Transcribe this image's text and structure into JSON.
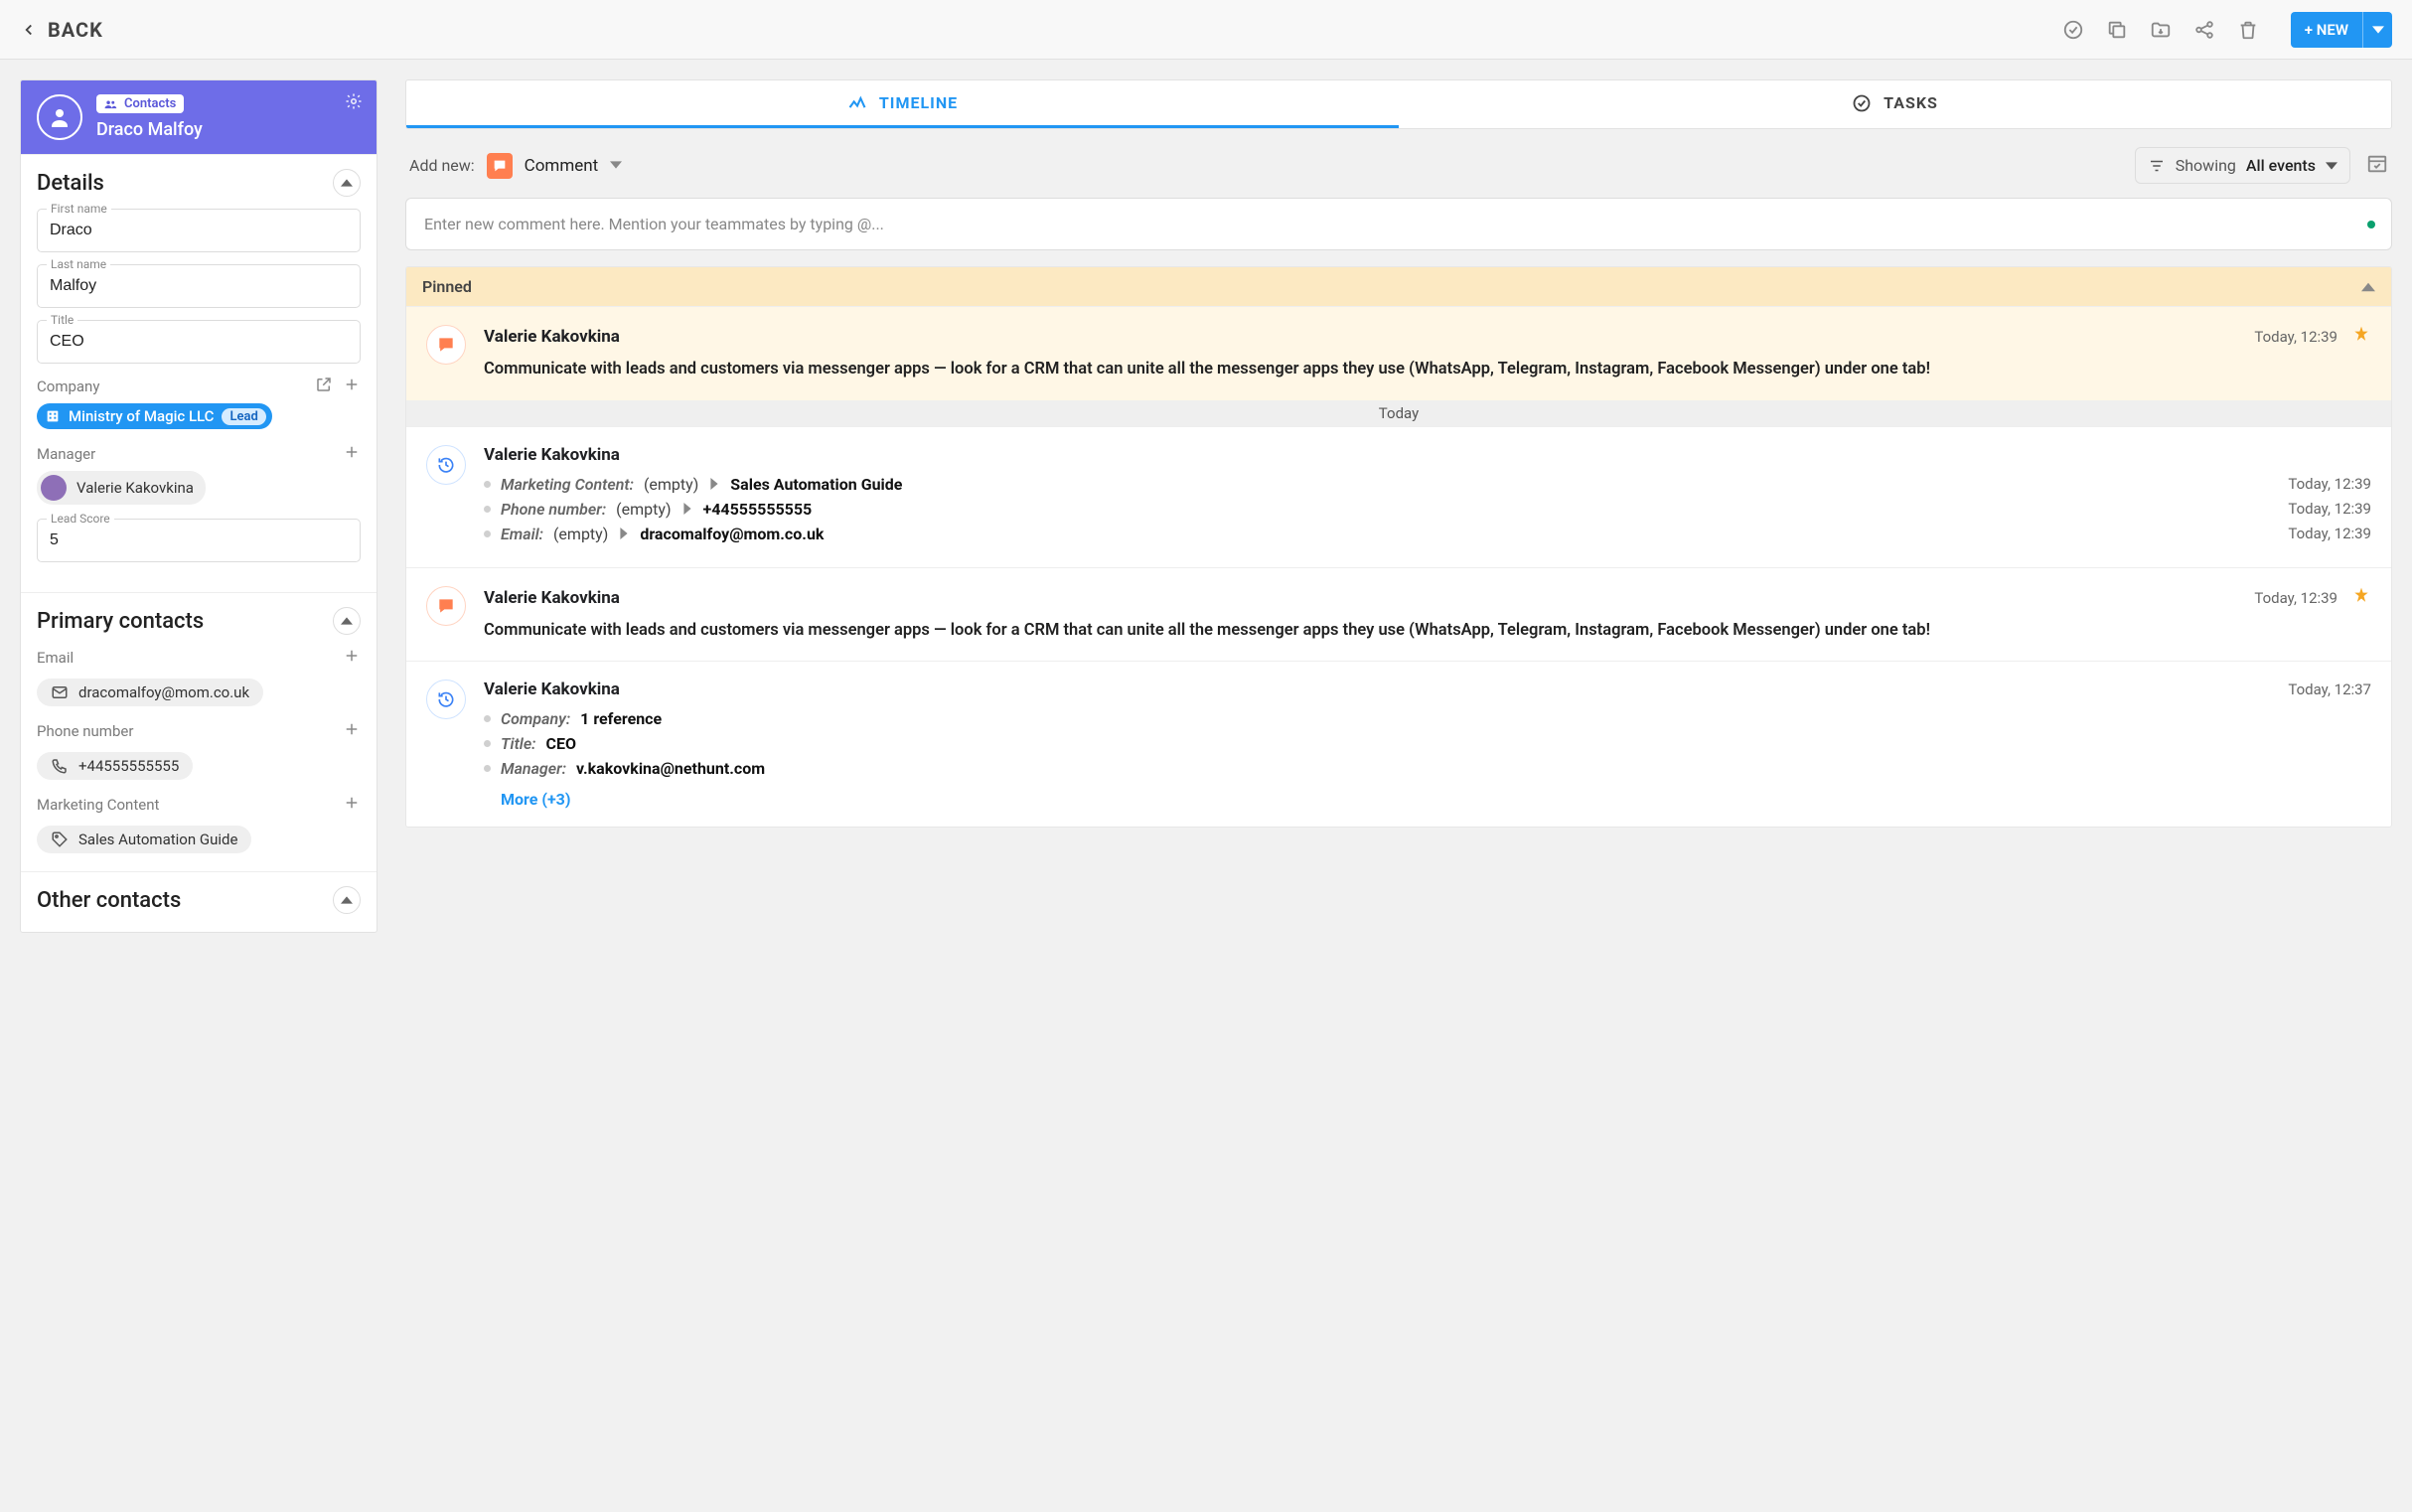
{
  "topbar": {
    "back_label": "BACK",
    "new_button_label": "+ NEW"
  },
  "record": {
    "folder_badge": "Contacts",
    "display_name": "Draco Malfoy"
  },
  "details": {
    "section_title": "Details",
    "first_name": {
      "label": "First name",
      "value": "Draco"
    },
    "last_name": {
      "label": "Last name",
      "value": "Malfoy"
    },
    "title": {
      "label": "Title",
      "value": "CEO"
    },
    "company": {
      "label": "Company",
      "name": "Ministry of Magic LLC",
      "stage": "Lead"
    },
    "manager": {
      "label": "Manager",
      "name": "Valerie Kakovkina"
    },
    "lead_score": {
      "label": "Lead Score",
      "value": "5"
    }
  },
  "primary": {
    "section_title": "Primary contacts",
    "email": {
      "label": "Email",
      "value": "dracomalfoy@mom.co.uk"
    },
    "phone": {
      "label": "Phone number",
      "value": "+44555555555"
    },
    "content": {
      "label": "Marketing Content",
      "value": "Sales Automation Guide"
    }
  },
  "other": {
    "section_title": "Other contacts"
  },
  "tabs": {
    "timeline": "TIMELINE",
    "tasks": "TASKS"
  },
  "toolbar": {
    "add_new_label": "Add new:",
    "add_type": "Comment",
    "filter_prefix": "Showing",
    "filter_value": "All events",
    "comment_placeholder": "Enter new comment here. Mention your teammates by typing @..."
  },
  "pinned_label": "Pinned",
  "day_label": "Today",
  "entries": {
    "e0": {
      "author": "Valerie Kakovkina",
      "time": "Today, 12:39",
      "text": "Communicate with leads and customers via messenger apps — look for a CRM that can unite all the messenger apps they use (WhatsApp, Telegram, Instagram, Facebook Messenger) under one tab!"
    },
    "e1": {
      "author": "Valerie Kakovkina",
      "time": "Today, 12:39",
      "c0": {
        "field": "Marketing Content:",
        "from": "(empty)",
        "to": "Sales Automation Guide",
        "ts": "Today, 12:39"
      },
      "c1": {
        "field": "Phone number:",
        "from": "(empty)",
        "to": "+44555555555",
        "ts": "Today, 12:39"
      },
      "c2": {
        "field": "Email:",
        "from": "(empty)",
        "to": "dracomalfoy@mom.co.uk",
        "ts": "Today, 12:39"
      }
    },
    "e2": {
      "author": "Valerie Kakovkina",
      "time": "Today, 12:39",
      "text": "Communicate with leads and customers via messenger apps — look for a CRM that can unite all the messenger apps they use (WhatsApp, Telegram, Instagram, Facebook Messenger) under one tab!"
    },
    "e3": {
      "author": "Valerie Kakovkina",
      "time": "Today, 12:37",
      "c0": {
        "field": "Company:",
        "to": "1 reference"
      },
      "c1": {
        "field": "Title:",
        "to": "CEO"
      },
      "c2": {
        "field": "Manager:",
        "to": "v.kakovkina@nethunt.com"
      },
      "more": "More (+3)"
    }
  }
}
